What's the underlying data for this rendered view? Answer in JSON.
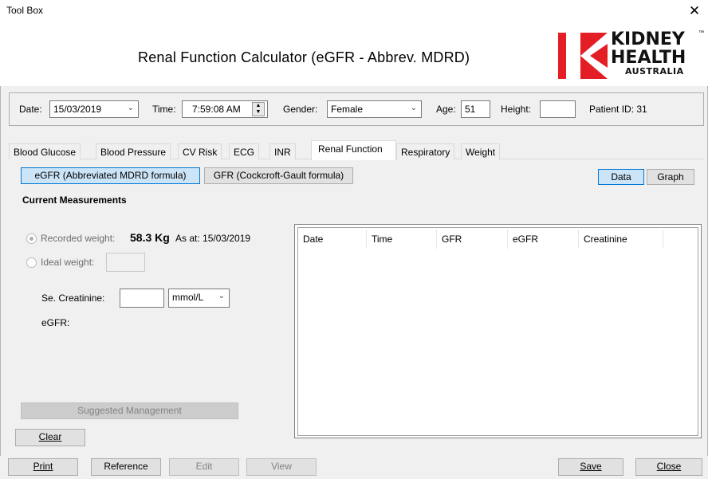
{
  "window": {
    "title": "Tool Box",
    "close_glyph": "✕"
  },
  "header": {
    "title": "Renal Function Calculator (eGFR - Abbrev. MDRD)",
    "logo": {
      "line1": "KIDNEY",
      "line2": "HEALTH",
      "line3": "AUSTRALIA",
      "tm": "™",
      "brand_color": "#e31e24"
    }
  },
  "info": {
    "date_label": "Date:",
    "date_value": "15/03/2019",
    "time_label": "Time:",
    "time_value": "7:59:08 AM",
    "gender_label": "Gender:",
    "gender_value": "Female",
    "age_label": "Age:",
    "age_value": "51",
    "height_label": "Height:",
    "height_value": "",
    "patient_id": "Patient ID: 31"
  },
  "tabs": [
    {
      "label": "Blood Glucose"
    },
    {
      "label": "Blood Pressure"
    },
    {
      "label": "CV Risk"
    },
    {
      "label": "ECG"
    },
    {
      "label": "INR"
    },
    {
      "label": "Renal Function",
      "active": true
    },
    {
      "label": "Respiratory"
    },
    {
      "label": "Weight"
    }
  ],
  "subtabs": {
    "egfr": "eGFR (Abbreviated MDRD formula)",
    "gfr": "GFR (Cockcroft-Gault formula)"
  },
  "view_toggle": {
    "data": "Data",
    "graph": "Graph"
  },
  "measurements": {
    "heading": "Current Measurements",
    "recorded_weight_label": "Recorded weight:",
    "recorded_weight_value": "58.3 Kg",
    "as_at": "As at: 15/03/2019",
    "ideal_weight_label": "Ideal weight:",
    "creatinine_label": "Se. Creatinine:",
    "creatinine_value": "",
    "unit_value": "mmol/L",
    "egfr_label": "eGFR:",
    "suggested_button": "Suggested Management",
    "clear_button": "Clear"
  },
  "table": {
    "columns": [
      "Date",
      "Time",
      "GFR",
      "eGFR",
      "Creatinine"
    ],
    "rows": []
  },
  "footer": {
    "print": "Print",
    "reference": "Reference",
    "edit": "Edit",
    "view": "View",
    "save": "Save",
    "close": "Close"
  }
}
